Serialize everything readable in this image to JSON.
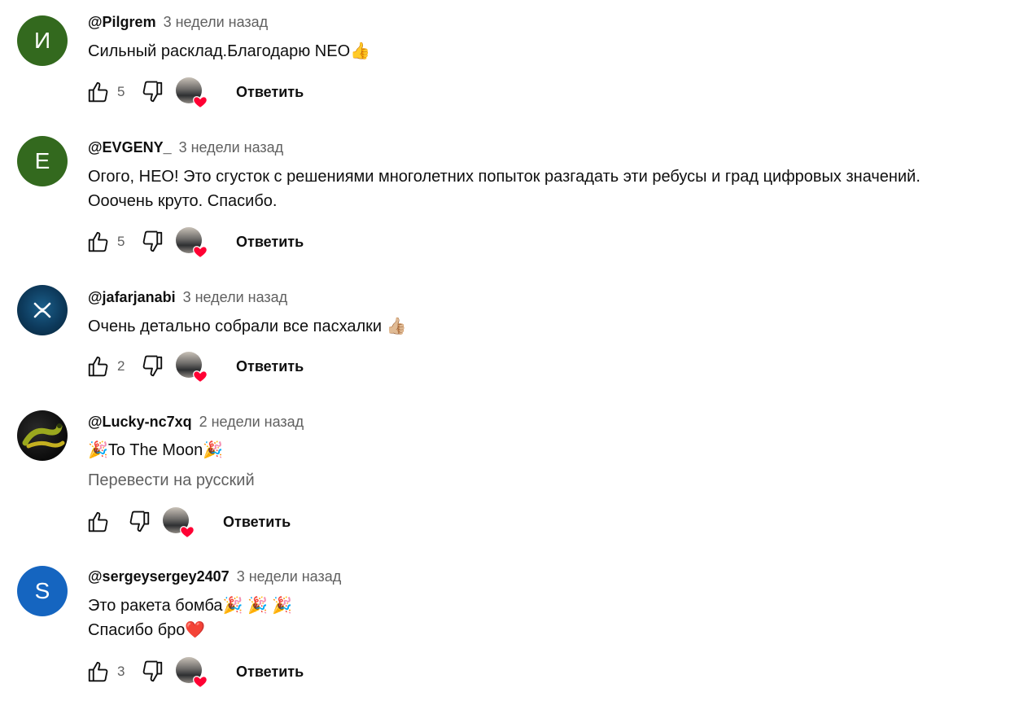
{
  "comments": [
    {
      "author": "@Pilgrem",
      "time": "3 недели назад",
      "avatar_letter": "И",
      "lines": [
        "Сильный расклад.Благодарю NEO👍"
      ],
      "likes": "5",
      "reply_label": "Ответить"
    },
    {
      "author": "@EVGENY_",
      "time": "3 недели назад",
      "avatar_letter": "E",
      "lines": [
        "Огого, НЕО! Это сгусток с решениями многолетних попыток разгадать эти ребусы и град цифровых значений.",
        "Ооочень круто. Спасибо."
      ],
      "likes": "5",
      "reply_label": "Ответить"
    },
    {
      "author": "@jafarjanabi",
      "time": "3 недели назад",
      "avatar_letter": "",
      "lines": [
        "Очень детально собрали все пасхалки 👍🏼"
      ],
      "likes": "2",
      "reply_label": "Ответить"
    },
    {
      "author": "@Lucky-nc7xq",
      "time": "2 недели назад",
      "avatar_letter": "",
      "lines": [
        "🎉To The Moon🎉"
      ],
      "translate_label": "Перевести на русский",
      "likes": "",
      "reply_label": "Ответить"
    },
    {
      "author": "@sergeysergey2407",
      "time": "3 недели назад",
      "avatar_letter": "S",
      "lines": [
        "Это ракета бомба🎉 🎉 🎉",
        "Спасибо бро❤️"
      ],
      "likes": "3",
      "reply_label": "Ответить"
    }
  ],
  "colors": {
    "avatar_green": "#33691e",
    "avatar_blue": "#1565c0",
    "heart_red": "#ff0033",
    "secondary_text": "#606060"
  }
}
